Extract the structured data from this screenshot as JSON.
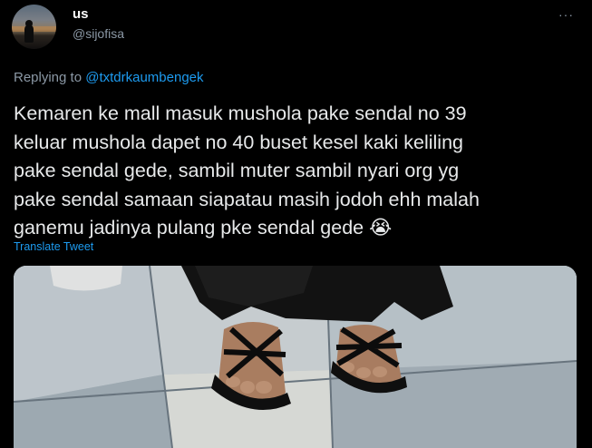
{
  "author": {
    "display_name": "us",
    "handle": "@sijofisa",
    "avatar_icon": "avatar-silhouette-sunset-icon"
  },
  "more_icon": "···",
  "reply": {
    "prefix": "Replying to",
    "mention": "@txtdrkaumbengek"
  },
  "tweet": {
    "lines": [
      "Kemaren ke mall masuk mushola pake sendal no 39",
      "keluar mushola dapet no 40 buset kesel kaki keliling",
      "pake sendal gede, sambil muter sambil nyari org yg",
      "pake sendal samaan siapatau masih jodoh ehh malah",
      "ganemu jadinya pulang pke sendal gede 😭"
    ]
  },
  "translate_label": "Translate Tweet",
  "media": {
    "description_icon": "photo-feet-sandals-icon"
  },
  "colors": {
    "background": "#000000",
    "text": "#e7e9ea",
    "secondary": "#8b98a5",
    "accent": "#1d9bf0"
  }
}
